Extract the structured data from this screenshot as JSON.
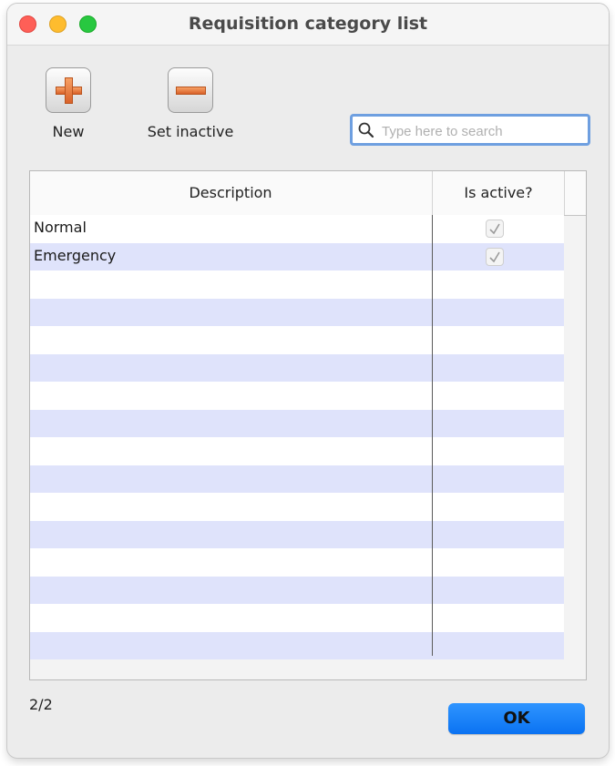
{
  "window": {
    "title": "Requisition category list"
  },
  "toolbar": {
    "new_label": "New",
    "set_inactive_label": "Set inactive"
  },
  "search": {
    "placeholder": "Type here to search",
    "value": ""
  },
  "table": {
    "columns": [
      "Description",
      "Is active?"
    ],
    "rows": [
      {
        "description": "Normal",
        "is_active": true
      },
      {
        "description": "Emergency",
        "is_active": true
      }
    ],
    "empty_row_count": 14
  },
  "footer": {
    "count": "2/2",
    "ok_label": "OK"
  },
  "colors": {
    "accent": "#0a72f2",
    "stripe": "#dfe3fb",
    "close": "#fe5f57",
    "minimize": "#febc2e",
    "maximize": "#28c840"
  },
  "icons": [
    "close-icon",
    "minimize-icon",
    "maximize-icon",
    "plus-icon",
    "minus-icon",
    "search-icon",
    "checkmark-icon"
  ]
}
